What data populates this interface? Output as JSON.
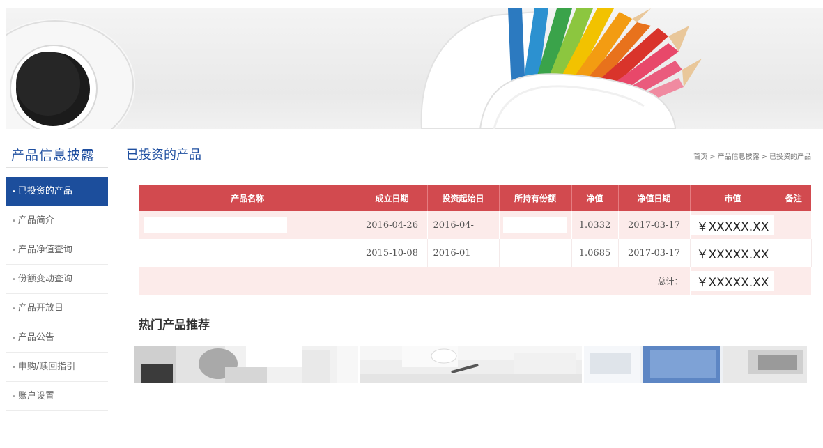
{
  "sidebar": {
    "title": "产品信息披露",
    "items": [
      {
        "label": "已投资的产品",
        "active": true
      },
      {
        "label": "产品简介",
        "active": false
      },
      {
        "label": "产品净值查询",
        "active": false
      },
      {
        "label": "份额变动查询",
        "active": false
      },
      {
        "label": "产品开放日",
        "active": false
      },
      {
        "label": "产品公告",
        "active": false
      },
      {
        "label": "申购/赎回指引",
        "active": false
      },
      {
        "label": "账户设置",
        "active": false
      }
    ]
  },
  "main": {
    "title": "已投资的产品",
    "breadcrumb": [
      "首页",
      "产品信息披露",
      "已投资的产品"
    ],
    "breadcrumb_sep": ">"
  },
  "table": {
    "headers": [
      "产品名称",
      "成立日期",
      "投资起始日",
      "所持有份额",
      "净值",
      "净值日期",
      "市值",
      "备注"
    ],
    "rows": [
      {
        "name": "",
        "established": "2016-04-26",
        "start": "2016-04-",
        "shares": "",
        "nav": "1.0332",
        "nav_date": "2017-03-17",
        "market_value": "￥XXXXX.XX",
        "note": ""
      },
      {
        "name": "",
        "established": "2015-10-08",
        "start": "2016-01",
        "shares": "",
        "nav": "1.0685",
        "nav_date": "2017-03-17",
        "market_value": "￥XXXXX.XX",
        "note": ""
      }
    ],
    "total": {
      "label": "总计：",
      "market_value": "￥XXXXX.XX"
    }
  },
  "hot": {
    "title": "热门产品推荐",
    "images": [
      "office-desk-photo",
      "coffee-cup-photo",
      "calculator-photo"
    ]
  },
  "colors": {
    "accent_blue": "#1c4e9c",
    "header_red": "#d24a4f",
    "row_pink": "#fcebea"
  },
  "icons": {
    "banner": [
      "coffee-cup-icon",
      "pencil-cup-icon"
    ]
  }
}
